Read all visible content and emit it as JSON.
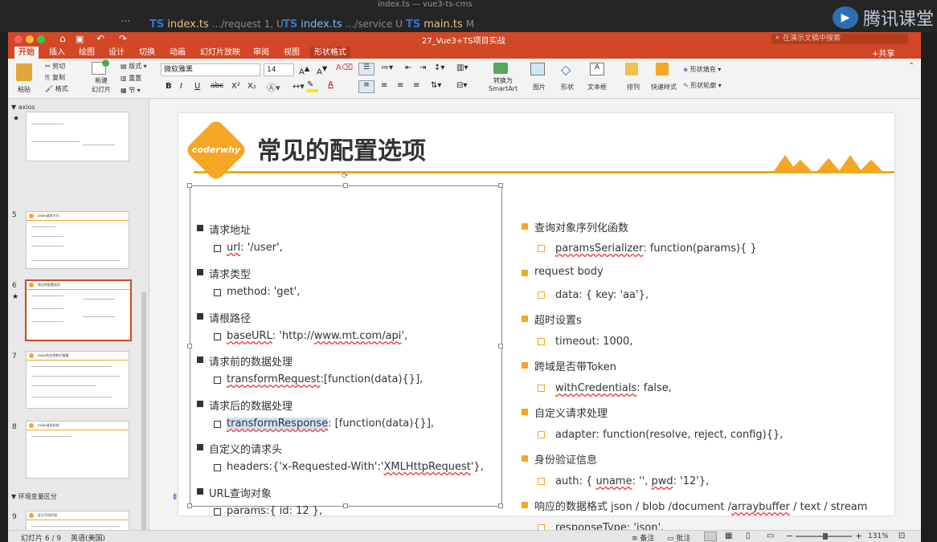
{
  "editor": {
    "window_title": "index.ts — vue3-ts-cms",
    "tabs": [
      {
        "icon": "TS",
        "name": "index.ts",
        "path": ".../request 1, U"
      },
      {
        "icon": "TS",
        "name": "index.ts",
        "path": ".../service U"
      },
      {
        "icon": "TS",
        "name": "main.ts",
        "path": "M"
      }
    ],
    "overflow": "···"
  },
  "brand": {
    "text": "腾讯课堂"
  },
  "app": {
    "doc_title": "27_Vue3+TS项目实战",
    "search_placeholder": "在演示文稿中搜索",
    "share_label": "共享",
    "menu_tabs": [
      "开始",
      "插入",
      "绘图",
      "设计",
      "切换",
      "动画",
      "幻灯片放映",
      "审阅",
      "视图",
      "形状格式"
    ],
    "active_tab": "开始"
  },
  "ribbon": {
    "paste": "粘贴",
    "cut": "剪切",
    "copy": "复制",
    "format": "格式",
    "new_slide": "新建\n幻灯片",
    "layout": "版式",
    "reset": "重置",
    "section": "节",
    "font_name": "微软雅黑",
    "font_size": "14",
    "convert_smartart": "转换为\nSmartArt",
    "picture": "图片",
    "shape": "形状",
    "textbox": "文本框",
    "arrange": "排列",
    "quick_styles": "快速样式",
    "shape_fill": "形状填充",
    "shape_outline": "形状轮廓",
    "format_buttons": [
      "B",
      "I",
      "U",
      "abc",
      "X²",
      "X₂",
      "A"
    ]
  },
  "thumbs": {
    "section_axios": "axios",
    "section_env": "环境变量区分",
    "slides": [
      {
        "num": "",
        "title": ""
      },
      {
        "num": "5",
        "title": "axios请求方式"
      },
      {
        "num": "6",
        "title": "常见的配置选项"
      },
      {
        "num": "7",
        "title": "axios的实例和拦截器"
      },
      {
        "num": "8",
        "title": "axios请求封装"
      },
      {
        "num": "9",
        "title": "区分不同环境"
      }
    ]
  },
  "slide": {
    "logo": "coderwhy",
    "title": "常见的配置选项",
    "left": [
      {
        "h": "请求地址",
        "v": [
          "url",
          ": '/user',"
        ]
      },
      {
        "h": "请求类型",
        "v": [
          "",
          "method: 'get',"
        ]
      },
      {
        "h": "请根路径",
        "v": [
          "baseURL",
          ": 'http://",
          "www.mt.com/api",
          "',"
        ]
      },
      {
        "h": "请求前的数据处理",
        "v": [
          "transformRequest",
          ":[function(data){}],"
        ]
      },
      {
        "h": "请求后的数据处理",
        "v": [
          "transformResponse",
          ": [function(data){}],"
        ]
      },
      {
        "h": "自定义的请求头",
        "v": [
          "",
          "headers:{'x-Requested-With':'",
          "XMLHttpRequest",
          "'},"
        ]
      },
      {
        "h": "URL查询对象",
        "v": [
          "",
          "params:{ id: 12 },"
        ]
      }
    ],
    "right": [
      {
        "h": "查询对象序列化函数",
        "v": [
          "paramsSerializer",
          ": function(params){ }"
        ]
      },
      {
        "h": "request body",
        "v": [
          "",
          "data: { key: 'aa'},"
        ]
      },
      {
        "h": "超时设置s",
        "v": [
          "",
          "timeout: 1000,"
        ]
      },
      {
        "h": "跨域是否带Token",
        "v": [
          "withCredentials",
          ": false,"
        ]
      },
      {
        "h": "自定义请求处理",
        "v": [
          "",
          "adapter: function(resolve, reject, config){},"
        ]
      },
      {
        "h": "身份验证信息",
        "v": [
          "",
          "auth: { ",
          "uname",
          ": '', ",
          "pwd",
          ": '12'},"
        ]
      },
      {
        "h_parts": [
          "响应的数据格式 json / blob /document /",
          "arraybuffer",
          " / text / stream"
        ],
        "v": [
          "responseType",
          ": 'json',"
        ]
      }
    ]
  },
  "status": {
    "slide_info": "幻灯片 6 / 9",
    "language": "英语(美国)",
    "notes": "备注",
    "comments": "批注",
    "zoom": "131%"
  }
}
